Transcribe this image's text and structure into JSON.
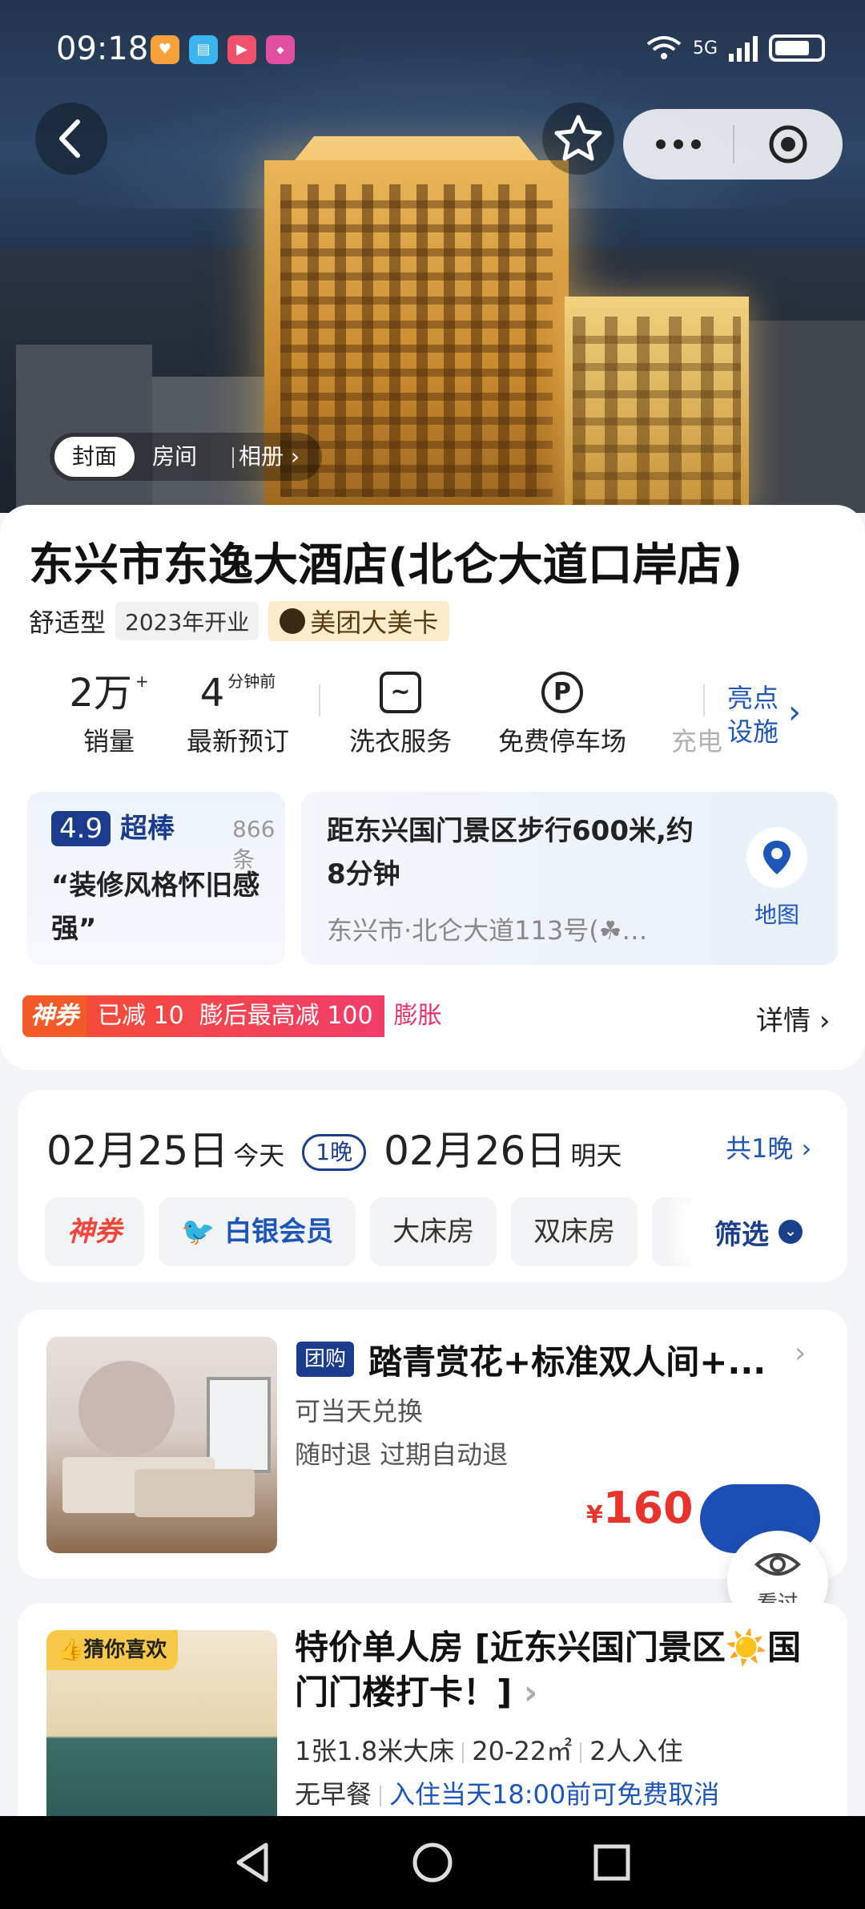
{
  "status": {
    "time": "09:18",
    "network": "5G"
  },
  "hero": {
    "tabs": [
      "封面",
      "房间",
      "相册"
    ],
    "back_icon": "chevron-left-icon",
    "fav_icon": "star-icon",
    "more_icon": "more-dots-icon",
    "close_icon": "target-icon"
  },
  "hotel": {
    "name": "东兴市东逸大酒店(北仑大道口岸店)",
    "type": "舒适型",
    "opened": "2023年开业",
    "card": "美团大美卡"
  },
  "stats": {
    "sales_num": "2万",
    "sales_sup": "+",
    "sales_label": "销量",
    "recent_num": "4",
    "recent_sup": "分钟前",
    "recent_label": "最新预订",
    "laundry_label": "洗衣服务",
    "parking_label": "免费停车场",
    "more_label": "充电",
    "highlight_line1": "亮点",
    "highlight_line2": "设施"
  },
  "review": {
    "score": "4.9",
    "word": "超棒",
    "count": "866条",
    "quote": "“装修风格怀旧感强”"
  },
  "location": {
    "desc": "距东兴国门景区步行600米,约8分钟",
    "address": "东兴市·北仑大道113号(☘…",
    "map_label": "地图"
  },
  "coupon": {
    "tag": "神券",
    "text": "已减 10  膨后最高减 100",
    "expand": "膨胀",
    "detail": "详情"
  },
  "dates": {
    "checkin": "02月25日",
    "checkin_sub": "今天",
    "nights": "1晚",
    "checkout": "02月26日",
    "checkout_sub": "明天",
    "total": "共1晚"
  },
  "filters": {
    "chips": [
      "神券",
      "白银会员",
      "大床房",
      "双床房"
    ],
    "filter_label": "筛选"
  },
  "room1": {
    "badge": "团购",
    "title": "踏青赏花+标准双人间+...",
    "line1": "可当天兑换",
    "line2": "随时退 过期自动退",
    "currency": "¥",
    "price": "160",
    "seen_label": "看过"
  },
  "room2": {
    "badge": "猜你喜欢",
    "title": "特价单人房 [近东兴国门景区☀️国门门楼打卡！]",
    "spec_bed": "1张1.8米大床",
    "spec_area": "20-22㎡",
    "spec_people": "2人入住",
    "breakfast": "无早餐",
    "cancel": "入住当天18:00前可免费取消"
  }
}
